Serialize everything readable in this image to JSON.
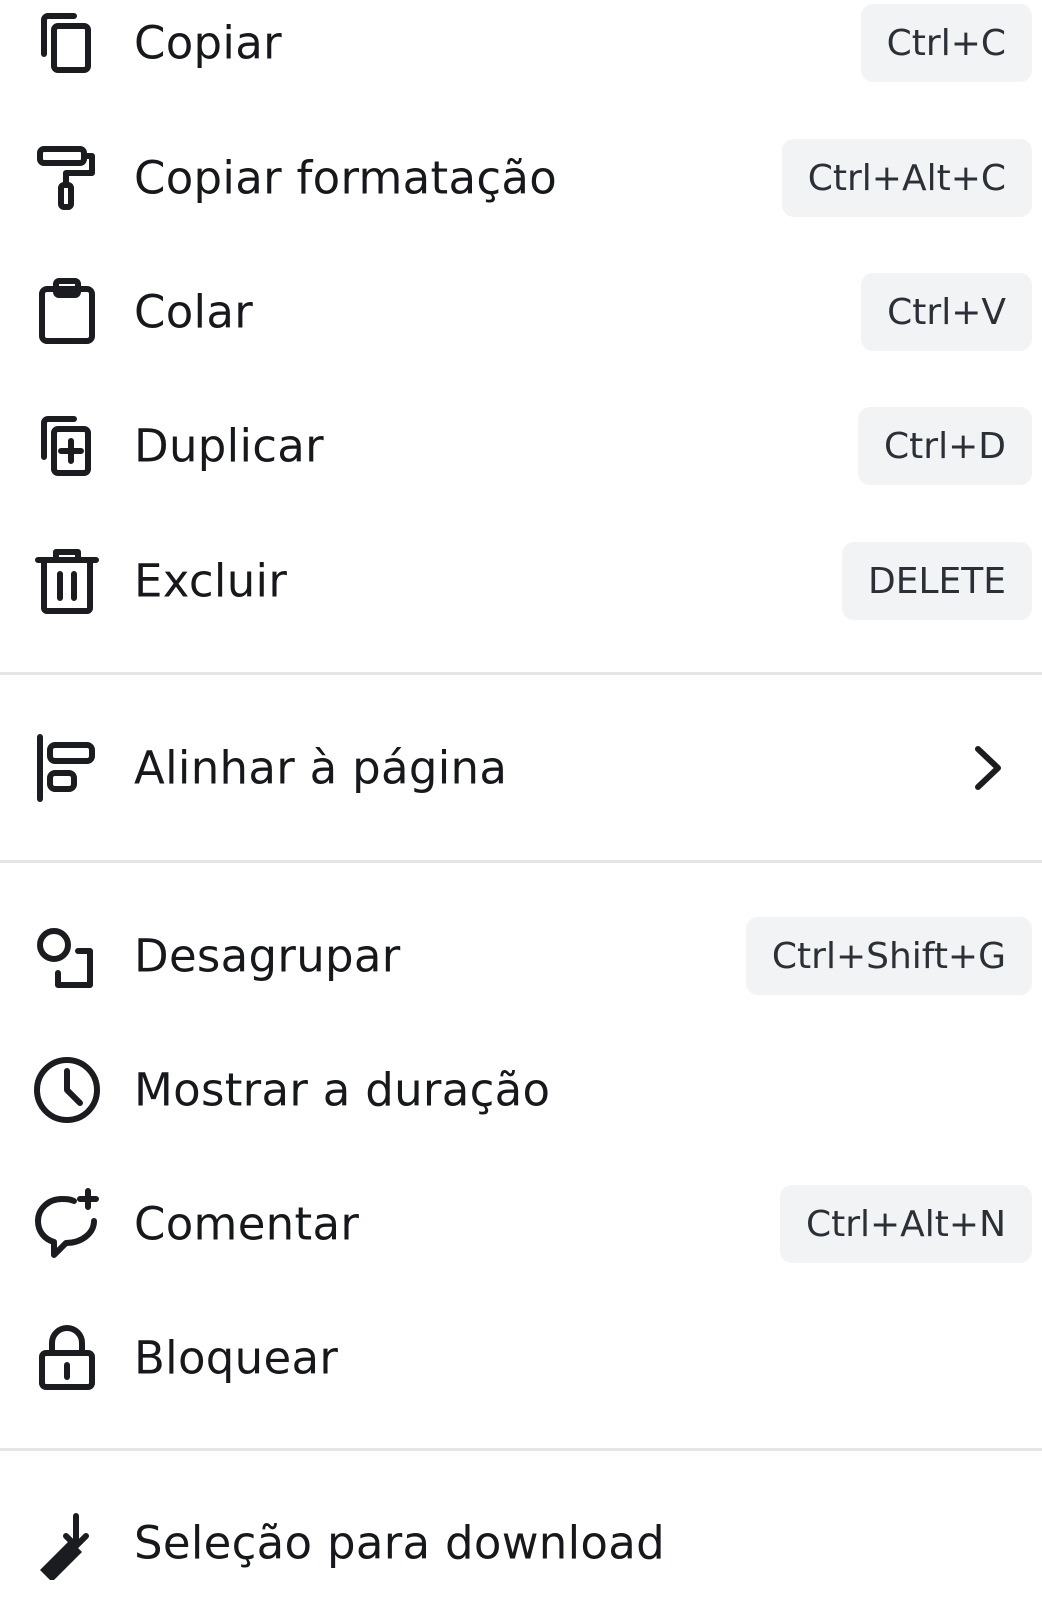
{
  "menu": {
    "items": [
      {
        "label": "Copiar",
        "shortcut": "Ctrl+C",
        "icon": "copy-icon"
      },
      {
        "label": "Copiar formatação",
        "shortcut": "Ctrl+Alt+C",
        "icon": "paint-roller-icon"
      },
      {
        "label": "Colar",
        "shortcut": "Ctrl+V",
        "icon": "clipboard-icon"
      },
      {
        "label": "Duplicar",
        "shortcut": "Ctrl+D",
        "icon": "duplicate-icon"
      },
      {
        "label": "Excluir",
        "shortcut": "DELETE",
        "icon": "trash-icon"
      },
      {
        "label": "Alinhar à página",
        "icon": "align-left-icon",
        "submenu_icon": "chevron-right-icon"
      },
      {
        "label": "Desagrupar",
        "shortcut": "Ctrl+Shift+G",
        "icon": "ungroup-icon"
      },
      {
        "label": "Mostrar a duração",
        "icon": "clock-icon"
      },
      {
        "label": "Comentar",
        "shortcut": "Ctrl+Alt+N",
        "icon": "comment-add-icon"
      },
      {
        "label": "Bloquear",
        "icon": "lock-icon"
      },
      {
        "label": "Seleção para download",
        "icon": "download-icon"
      }
    ]
  }
}
